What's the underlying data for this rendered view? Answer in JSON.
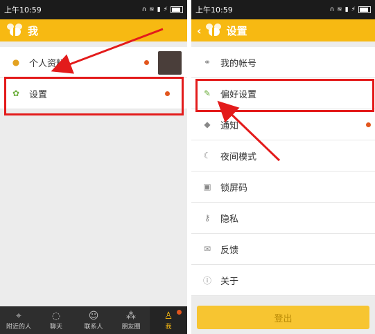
{
  "left": {
    "status": {
      "time": "上午10:59"
    },
    "header": {
      "title": "我"
    },
    "items": [
      {
        "label": "个人资料"
      },
      {
        "label": "设置"
      }
    ],
    "tabs": [
      {
        "label": "附近的人",
        "icon": "location-pin-icon"
      },
      {
        "label": "聊天",
        "icon": "chat-bubble-icon"
      },
      {
        "label": "联系人",
        "icon": "contacts-icon"
      },
      {
        "label": "朋友圈",
        "icon": "friends-circle-icon"
      },
      {
        "label": "我",
        "icon": "person-icon"
      }
    ]
  },
  "right": {
    "status": {
      "time": "上午10:59"
    },
    "header": {
      "title": "设置"
    },
    "items": [
      {
        "label": "我的帐号",
        "icon": "link-icon"
      },
      {
        "label": "偏好设置",
        "icon": "brush-icon"
      },
      {
        "label": "通知",
        "icon": "bell-icon"
      },
      {
        "label": "夜间模式",
        "icon": "moon-icon"
      },
      {
        "label": "锁屏码",
        "icon": "lock-icon"
      },
      {
        "label": "隐私",
        "icon": "key-icon"
      },
      {
        "label": "反馈",
        "icon": "mail-icon"
      },
      {
        "label": "关于",
        "icon": "info-icon"
      }
    ],
    "logout_label": "登出"
  },
  "colors": {
    "accent": "#f7b912",
    "highlight": "#e31b1b",
    "badge": "#e2561e"
  }
}
